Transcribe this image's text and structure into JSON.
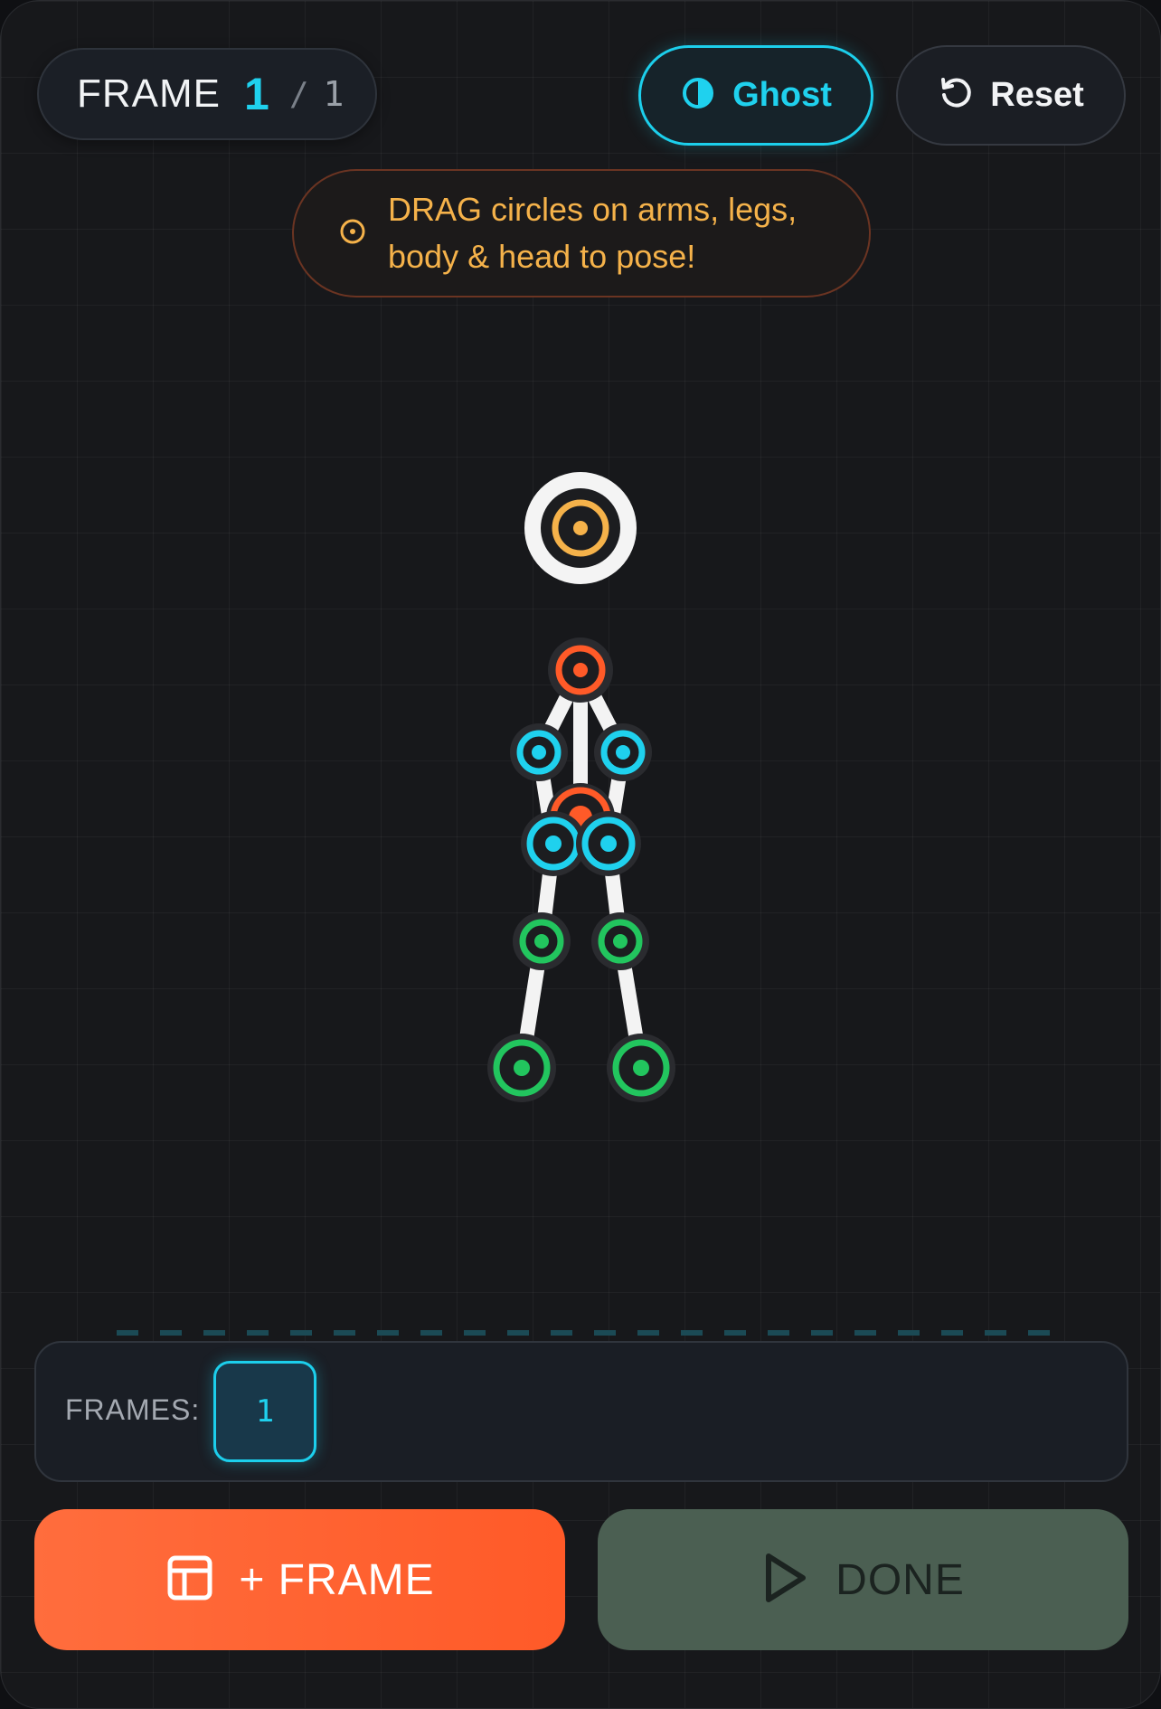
{
  "frame_counter": {
    "label": "FRAME",
    "current": "1",
    "separator": "/",
    "total": "1"
  },
  "toolbar": {
    "ghost_label": "Ghost",
    "reset_label": "Reset"
  },
  "hint": {
    "text": "DRAG circles on arms, legs, body & head to pose!"
  },
  "timeline": {
    "label": "FRAMES:",
    "frames": [
      "1"
    ]
  },
  "actions": {
    "add_frame_label": "+ FRAME",
    "done_label": "DONE"
  },
  "colors": {
    "accent": "#1fd1ee",
    "orange": "#ff5a28",
    "hint": "#f5b24a",
    "leg": "#22c55e",
    "head_core": "#f5b24a"
  }
}
